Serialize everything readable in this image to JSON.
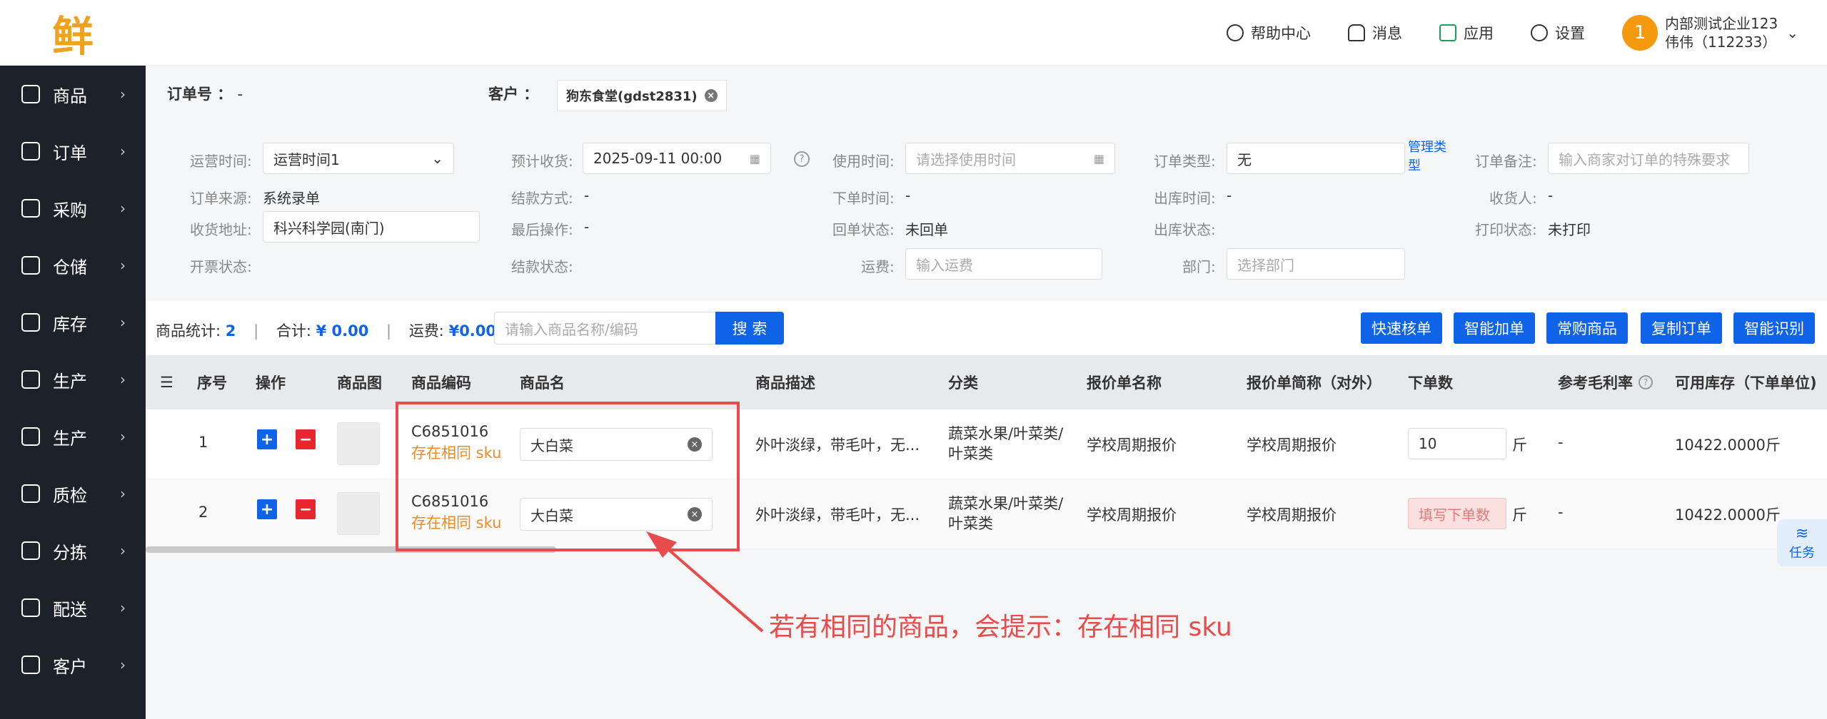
{
  "logo": "鲜",
  "nav": [
    "商品",
    "订单",
    "采购",
    "仓储",
    "库存",
    "生产",
    "生产",
    "质检",
    "分拣",
    "配送",
    "客户"
  ],
  "header": {
    "help": "帮助中心",
    "msg": "消息",
    "apps": "应用",
    "settings": "设置",
    "avatar": "1",
    "company": "内部测试企业123",
    "user": "伟伟（112233）"
  },
  "order": {
    "no_label": "订单号",
    "no_value": "-",
    "cust_label": "客户",
    "cust_tag": "狗东食堂(gdst2831)"
  },
  "fields": {
    "run_time_l": "运营时间:",
    "run_time_v": "运营时间1",
    "recv_l": "预计收货:",
    "recv_v": "2025-09-11 00:00",
    "use_l": "使用时间:",
    "use_ph": "请选择使用时间",
    "type_l": "订单类型:",
    "type_v": "无",
    "type_mgr": "管理类型",
    "remark_l": "订单备注:",
    "remark_ph": "输入商家对订单的特殊要求",
    "src_l": "订单来源:",
    "src_v": "系统录单",
    "pay_l": "结款方式:",
    "pay_v": "-",
    "order_t_l": "下单时间:",
    "order_t_v": "-",
    "out_t_l": "出库时间:",
    "out_t_v": "-",
    "receiver_l": "收货人:",
    "receiver_v": "-",
    "addr_l": "收货地址:",
    "addr_v": "科兴科学园(南门)",
    "last_l": "最后操作:",
    "last_v": "-",
    "back_l": "回单状态:",
    "back_v": "未回单",
    "outs_l": "出库状态:",
    "print_l": "打印状态:",
    "print_v": "未打印",
    "inv_l": "开票状态:",
    "pays_l": "结款状态:",
    "freight_l": "运费:",
    "freight_ph": "输入运费",
    "dept_l": "部门:",
    "dept_ph": "选择部门"
  },
  "bar": {
    "count_l": "商品统计:",
    "count_v": "2",
    "total_l": "合计:",
    "total_v": "¥ 0.00",
    "fee_l": "运费:",
    "fee_v": "¥0.00",
    "search_ph": "请输入商品名称/编码",
    "search_btn": "搜 索",
    "btns": [
      "快速核单",
      "智能加单",
      "常购商品",
      "复制订单",
      "智能识别"
    ]
  },
  "columns": [
    "序号",
    "操作",
    "商品图",
    "商品编码",
    "商品名",
    "商品描述",
    "分类",
    "报价单名称",
    "报价单简称（对外）",
    "下单数",
    "参考毛利率",
    "可用库存（下单单位)"
  ],
  "rows": [
    {
      "idx": "1",
      "code": "C6851016",
      "warn": "存在相同 sku",
      "name": "大白菜",
      "desc": "外叶淡绿，带毛叶，无...",
      "cat1": "蔬菜水果/叶菜类/",
      "cat2": "叶菜类",
      "quote": "学校周期报价",
      "quote_s": "学校周期报价",
      "qty": "10",
      "unit": "斤",
      "margin": "-",
      "stock": "10422.0000斤"
    },
    {
      "idx": "2",
      "code": "C6851016",
      "warn": "存在相同 sku",
      "name": "大白菜",
      "desc": "外叶淡绿，带毛叶，无...",
      "cat1": "蔬菜水果/叶菜类/",
      "cat2": "叶菜类",
      "quote": "学校周期报价",
      "quote_s": "学校周期报价",
      "qty": "填写下单数",
      "unit": "斤",
      "margin": "-",
      "stock": "10422.0000斤"
    }
  ],
  "annotation": "若有相同的商品，会提示：存在相同 sku",
  "task": "任务"
}
